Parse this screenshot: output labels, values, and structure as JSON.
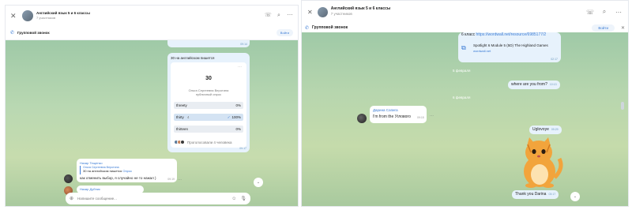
{
  "chat": {
    "title": "Английский язык 5 и 6 классы",
    "subtitle": "7 участников"
  },
  "call": {
    "label": "Групповой звонок",
    "join": "Войти"
  },
  "left": {
    "prev_time": "09:14",
    "poll": {
      "question": "30 на английском пишется",
      "big": "30",
      "author": "Ольга Сергеевна Веротина",
      "type": "публичный опрос",
      "options": [
        {
          "label": "threety",
          "pct": "0%"
        },
        {
          "label": "thirty",
          "pct": "100%",
          "count": "4"
        },
        {
          "label": "thirteen",
          "pct": "0%"
        }
      ],
      "voted": "Проголосовали 4 человека",
      "time": "09:17"
    },
    "reply": {
      "name": "Назар Тещенко",
      "quote_name": "Ольга Сергеевна Веротина",
      "quote_text": "30 на английском пишется",
      "quote_suffix": "Опрос",
      "text": "как отменить выбор, я случайно не то нажал )",
      "time": "09:19"
    },
    "next_name": "Назар Дубник",
    "composer_placeholder": "Напишите сообщение..."
  },
  "right": {
    "link_text": "6 класс",
    "link_url": "https://wordwall.net/resource/6985177/2",
    "card_title": "Spotlight 6 Module 5 (5D) The Highland Games",
    "card_site": "wordwall.net",
    "link_time": "02:17",
    "date1": "5 февраля",
    "out1": "where are you from?",
    "out1_time": "10:13",
    "date2": "6 февраля",
    "in_name": "Дарина Сапига",
    "in_text": "I'm from the Углового",
    "in_time": "09:15",
    "out2": "Uglovoye",
    "out2_time": "09:29",
    "out3": "Thank you Darina",
    "out3_time": "03:17"
  },
  "colors": {
    "accent": "#3a7bd5",
    "bubble_out": "#e7f2fc",
    "chat_bg": "#b7d6ae"
  }
}
